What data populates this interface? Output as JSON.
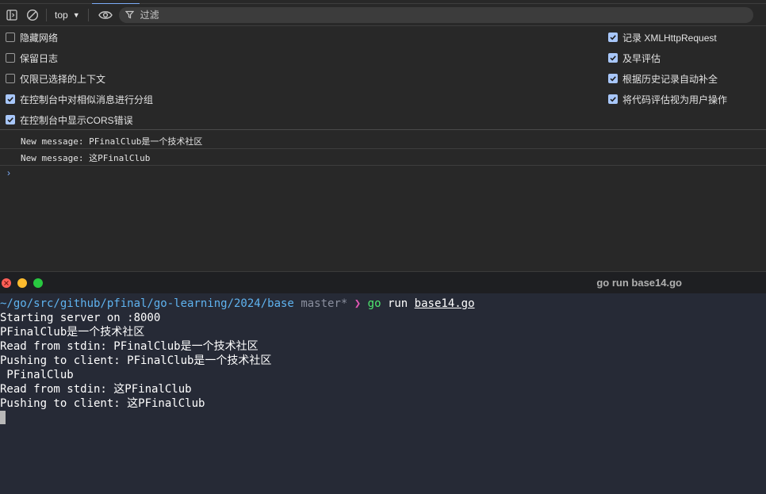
{
  "devtools": {
    "toolbar": {
      "context": "top",
      "filter_placeholder": "过滤"
    },
    "settings": {
      "left": [
        {
          "label": "隐藏网络",
          "checked": false
        },
        {
          "label": "保留日志",
          "checked": false
        },
        {
          "label": "仅限已选择的上下文",
          "checked": false
        },
        {
          "label": "在控制台中对相似消息进行分组",
          "checked": true
        },
        {
          "label": "在控制台中显示CORS错误",
          "checked": true
        }
      ],
      "right": [
        {
          "label": "记录 XMLHttpRequest",
          "checked": true
        },
        {
          "label": "及早评估",
          "checked": true
        },
        {
          "label": "根据历史记录自动补全",
          "checked": true
        },
        {
          "label": "将代码评估视为用户操作",
          "checked": true
        }
      ]
    },
    "messages": [
      "New message: PFinalClub是一个技术社区",
      "New message: 这PFinalClub"
    ],
    "accent_color": "#a8c7fa"
  },
  "terminal": {
    "title": "go run base14.go",
    "prompt": {
      "path": "~/go/src/github/pfinal/go-learning/2024/base",
      "branch": "master*",
      "arrow": "❯",
      "command": "go",
      "sub": "run",
      "arg": "base14.go"
    },
    "output": [
      "Starting server on :8000",
      "PFinalClub是一个技术社区",
      "Read from stdin: PFinalClub是一个技术社区",
      "Pushing to client: PFinalClub是一个技术社区",
      " PFinalClub",
      "Read from stdin: 这PFinalClub",
      "Pushing to client: 这PFinalClub"
    ]
  }
}
